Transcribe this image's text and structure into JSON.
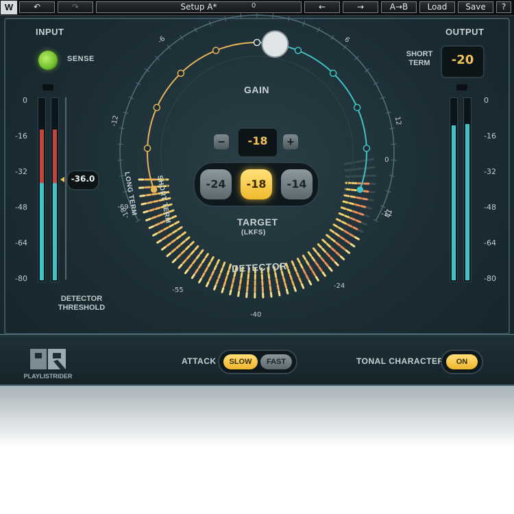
{
  "toolbar": {
    "undo_icon": "undo-icon",
    "redo_icon": "redo-icon",
    "setup_label": "Setup A*",
    "prev_icon": "arrow-left-icon",
    "next_icon": "arrow-right-icon",
    "ab_label": "A→B",
    "load_label": "Load",
    "save_label": "Save",
    "help_label": "?"
  },
  "input": {
    "title": "INPUT",
    "sense_label": "SENSE",
    "scale": [
      "0",
      "-16",
      "-32",
      "-48",
      "-64",
      "-80"
    ],
    "detector_threshold_value": "-36.0",
    "detector_threshold_label_1": "DETECTOR",
    "detector_threshold_label_2": "THRESHOLD",
    "left_meter": {
      "peak": 0.82,
      "level": 0.54
    },
    "right_meter": {
      "peak": 0.82,
      "level": 0.54
    }
  },
  "output": {
    "title": "OUTPUT",
    "short_term_label_1": "SHORT",
    "short_term_label_2": "TERM",
    "short_term_value": "-20",
    "scale": [
      "0",
      "-16",
      "-32",
      "-48",
      "-64",
      "-80"
    ],
    "left_meter": {
      "level": 0.85
    },
    "right_meter": {
      "level": 0.85
    }
  },
  "gain": {
    "label": "GAIN",
    "scale": [
      "-18",
      "-12",
      "-6",
      "0",
      "6",
      "12",
      "18"
    ],
    "value": "-18",
    "minus": "−",
    "plus": "+"
  },
  "target": {
    "options": [
      "-24",
      "-18",
      "-14"
    ],
    "selected": "-18",
    "label": "TARGET",
    "unit": "(LKFS)"
  },
  "detector": {
    "label": "DETECTOR",
    "long_term_label": "LONG TERM",
    "short_term_label": "SHORT TERM",
    "scale": [
      "-69",
      "-55",
      "-40",
      "-24",
      "-12",
      "0"
    ]
  },
  "bottom": {
    "product_name": "PLAYLISTRIDER",
    "attack_label": "ATTACK",
    "attack_slow": "SLOW",
    "attack_fast": "FAST",
    "attack_selected": "SLOW",
    "tonal_label": "TONAL CHARACTER",
    "tonal_value": "ON"
  },
  "colors": {
    "accent_yellow": "#f0c45a",
    "accent_teal": "#3fc4c8",
    "meter_red": "#c0453d",
    "led_green": "#7fcf34"
  }
}
